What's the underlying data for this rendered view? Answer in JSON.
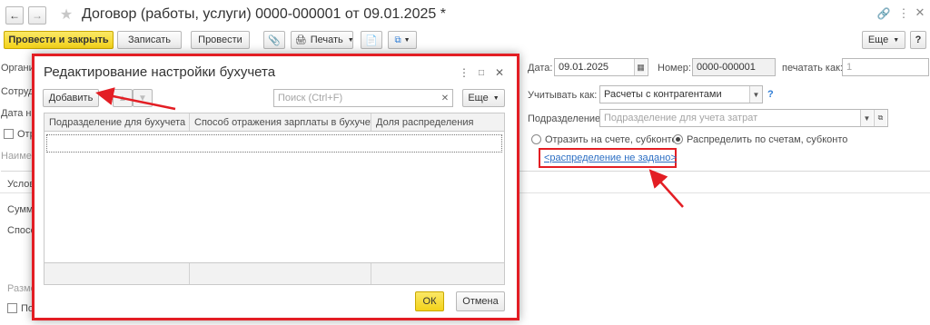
{
  "window": {
    "title": "Договор (работы, услуги) 0000-000001 от 09.01.2025 *",
    "more_label": "Еще"
  },
  "toolbar": {
    "post_close_label": "Провести и закрыть",
    "save_label": "Записать",
    "post_label": "Провести",
    "print_label": "Печать"
  },
  "header": {
    "date_label": "Дата:",
    "date_value": "09.01.2025",
    "number_label": "Номер:",
    "number_value": "0000-000001",
    "print_as_label": "печатать как:",
    "print_as_value": "1"
  },
  "accounting": {
    "account_as_label": "Учитывать как:",
    "account_as_value": "Расчеты с контрагентами",
    "help": "?",
    "division_label": "Подразделение:",
    "division_placeholder": "Подразделение для учета затрат",
    "radio_account": "Отразить на счете, субконто",
    "radio_distribute": "Распределить по счетам, субконто",
    "distribution_link": "<распределение не задано>"
  },
  "background_form": {
    "row_labels": [
      "Организ",
      "Сотруд",
      "Дата на",
      "Отр",
      "Наимен"
    ],
    "tab_labels": [
      "Услов",
      "Сумм",
      "Спосо"
    ],
    "bottom_labels": [
      "Разме",
      "По"
    ]
  },
  "dialog": {
    "title": "Редактирование настройки бухучета",
    "add_label": "Добавить",
    "search_placeholder": "Поиск (Ctrl+F)",
    "more_label": "Еще",
    "columns": [
      "Подразделение для бухучета",
      "Способ отражения зарплаты в бухучете",
      "Доля распределения"
    ],
    "ok_label": "ОК",
    "cancel_label": "Отмена"
  },
  "colors": {
    "primary_button": "#f3d21a",
    "highlight": "#e31e24",
    "link": "#2d6fc4"
  }
}
